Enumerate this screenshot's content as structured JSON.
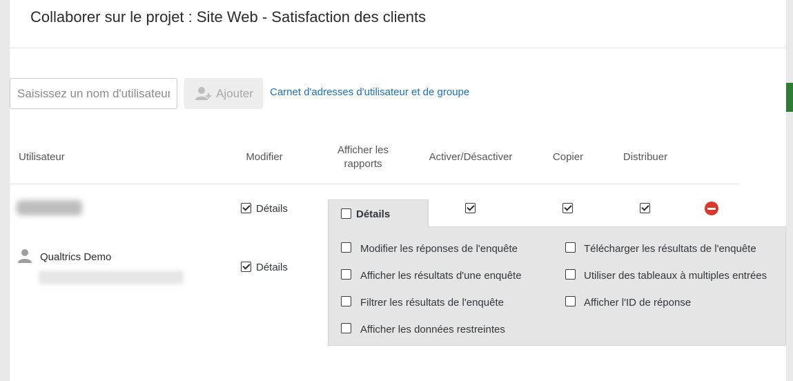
{
  "modal": {
    "title": "Collaborer sur le projet : Site Web - Satisfaction des clients"
  },
  "add_user": {
    "input_placeholder": "Saisissez un nom d'utilisateur",
    "add_button_label": "Ajouter",
    "address_book_link": "Carnet d'adresses d'utilisateur et de groupe"
  },
  "table": {
    "headers": {
      "user": "Utilisateur",
      "edit": "Modifier",
      "view_reports": "Afficher les rapports",
      "activate": "Activer/Désactiver",
      "copy": "Copier",
      "distribute": "Distribuer"
    },
    "rows": [
      {
        "user_name": "",
        "edit_checked": true,
        "edit_label": "Détails",
        "view_reports_label": "Détails",
        "view_reports_checked": false,
        "activate_checked": true,
        "copy_checked": true,
        "distribute_checked": true
      },
      {
        "user_name": "Qualtrics Demo",
        "edit_checked": true,
        "edit_label": "Détails"
      }
    ]
  },
  "details_panel": {
    "options_left": [
      "Modifier les réponses de l'enquête",
      "Afficher les résultats d'une enquête",
      "Filtrer les résultats de l'enquête",
      "Afficher les données restreintes"
    ],
    "options_right": [
      "Télécharger les résultats de l'enquête",
      "Utiliser des tableaux à multiples entrées",
      "Afficher l'ID de réponse"
    ]
  },
  "colors": {
    "link": "#1f6fb2",
    "remove": "#d9382c",
    "panel_bg": "#e5e5e5"
  }
}
